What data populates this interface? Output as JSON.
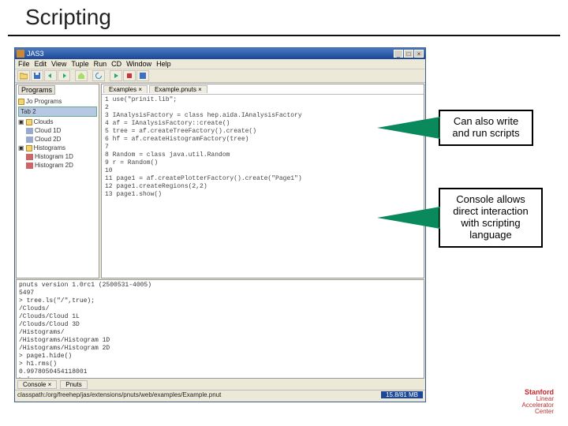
{
  "page": {
    "title": "Scripting"
  },
  "window": {
    "title": "JAS3",
    "buttons": {
      "min": "_",
      "max": "□",
      "close": "×"
    }
  },
  "menu": [
    "File",
    "Edit",
    "View",
    "Tuple",
    "Run",
    "CD",
    "Window",
    "Help"
  ],
  "sidebar": {
    "tab": "Programs",
    "nodes": {
      "root": "Jo Programs",
      "tab2": "Tab 2",
      "clouds": "Clouds",
      "c1": "Cloud 1D",
      "c2": "Cloud 2D",
      "hist": "Histograms",
      "h1": "Histogram 1D",
      "h2": "Histogram 2D"
    }
  },
  "editor": {
    "tabs": [
      "Examples ×",
      "Example.pnuts ×"
    ],
    "code": "1 use(\"prinit.lib\";\n2\n3 IAnalysisFactory = class hep.aida.IAnalysisFactory\n4 af = IAnalysisFactory::create()\n5 tree = af.createTreeFactory().create()\n6 hf = af.createHistogramFactory(tree)\n7\n8 Random = class java.util.Random\n9 r = Random()\n10\n11 page1 = af.createPlotterFactory().create(\"Page1\")\n12 page1.createRegions(2,2)\n13 page1.show()"
  },
  "console": {
    "text": "pnuts version 1.0rc1 (2500531-4005)\n5497\n> tree.ls(\"/\",true);\n/Clouds/\n/Clouds/Cloud 1L\n/Clouds/Cloud 3D\n/Histograms/\n/Histograms/Histogram 1D\n/Histograms/Histogram 2D\n> page1.hide()\n> h1.rms()\n0.9978050454118001\n> |"
  },
  "bottomTabs": [
    "Console ×",
    "Pnuts"
  ],
  "status": {
    "left": "classpath:/org/freehep/jas/extensions/pnuts/web/examples/Example.pnut",
    "right": "15.8/81 MB"
  },
  "callouts": {
    "c1": "Can also write and run scripts",
    "c2": "Console allows direct interaction with scripting language"
  },
  "logo": {
    "l1": "Stanford",
    "l2": "Linear",
    "l3": "Accelerator",
    "l4": "Center"
  }
}
